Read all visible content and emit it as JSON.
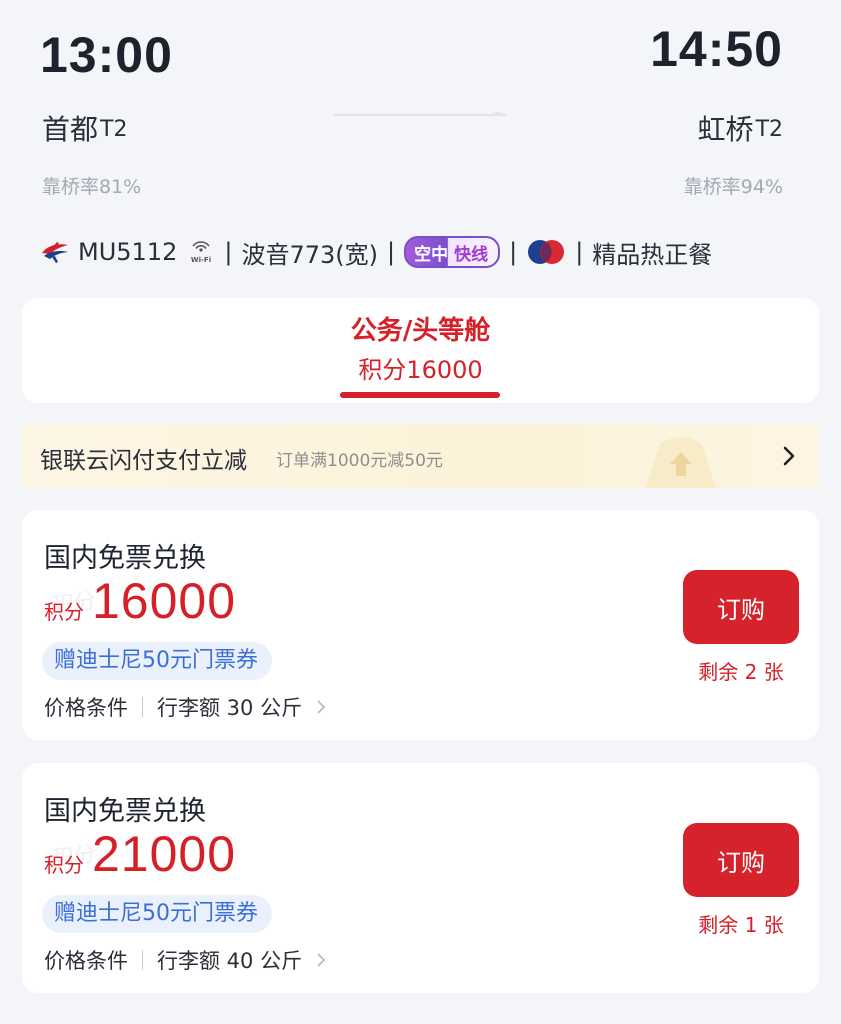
{
  "flight": {
    "departure": {
      "time": "13:00",
      "airport": "首都",
      "terminal": "T2",
      "bridge_rate": "靠桥率81%"
    },
    "arrival": {
      "time": "14:50",
      "airport": "虹桥",
      "terminal": "T2",
      "bridge_rate": "靠桥率94%"
    },
    "info": {
      "flight_no": "MU5112",
      "aircraft": "波音773(宽)",
      "badge_left": "空中",
      "badge_right": "快线",
      "meal": "精品热正餐",
      "separator": "|"
    },
    "icons": {
      "airline": "china-eastern-logo",
      "wifi": "wifi-icon",
      "meal": "meal-logo-icon"
    }
  },
  "cabin_tab": {
    "name": "公务/头等舱",
    "points": "积分16000"
  },
  "promo": {
    "title": "银联云闪付支付立减",
    "description": "订单满1000元减50元"
  },
  "offers": [
    {
      "title": "国内免票兑换",
      "points_label": "积分",
      "points": "16000",
      "gift": "赠迪士尼50元门票券",
      "condition": "价格条件",
      "baggage": "行李额 30 公斤",
      "button": "订购",
      "remaining": "剩余 2 张"
    },
    {
      "title": "国内免票兑换",
      "points_label": "积分",
      "points": "21000",
      "gift": "赠迪士尼50元门票券",
      "condition": "价格条件",
      "baggage": "行李额 40 公斤",
      "button": "订购",
      "remaining": "剩余 1 张"
    }
  ],
  "colors": {
    "brand_red": "#d71f28",
    "gift_blue": "#3d6ed6",
    "background": "#f4f5f9"
  }
}
